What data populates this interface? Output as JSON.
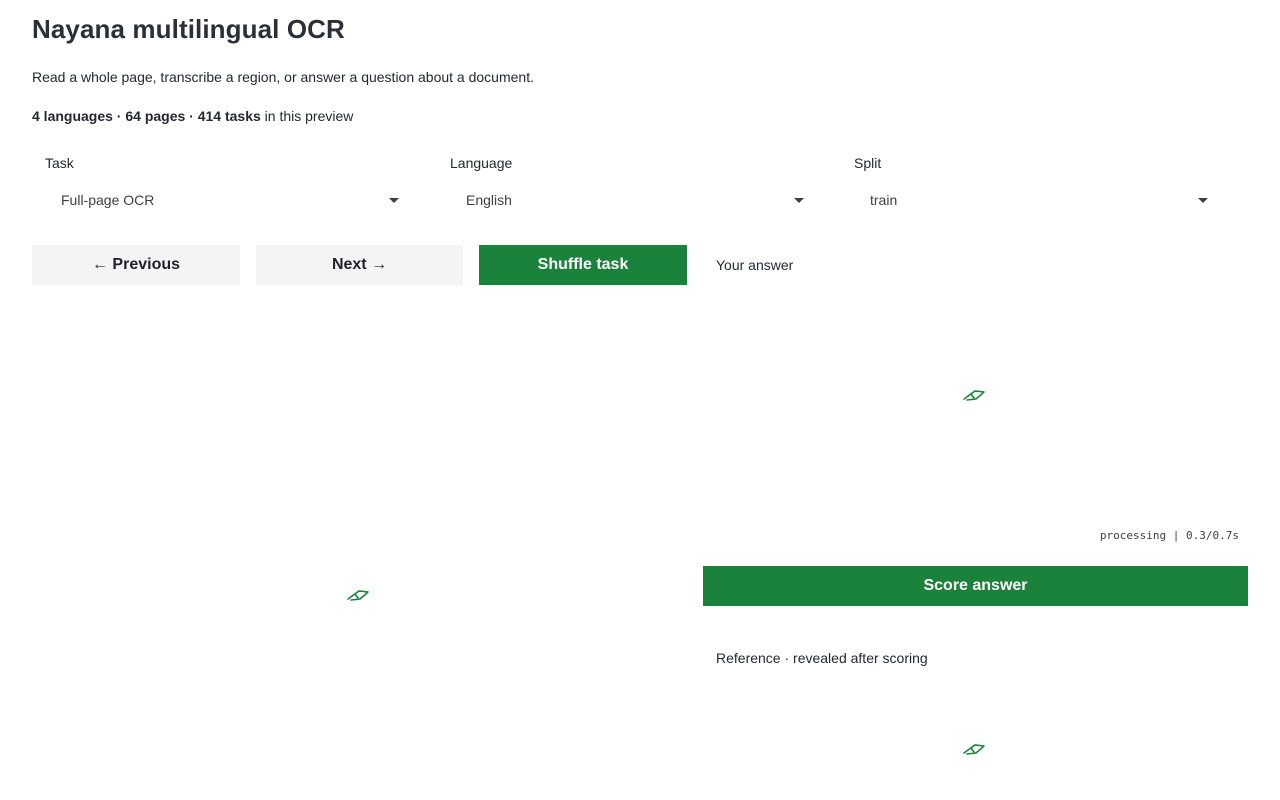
{
  "header": {
    "title": "Nayana multilingual OCR",
    "subtitle": "Read a whole page, transcribe a region, or answer a question about a document.",
    "stats_bold": "4 languages · 64 pages · 414 tasks",
    "stats_suffix": " in this preview"
  },
  "controls": {
    "task": {
      "label": "Task",
      "value": "Full-page OCR"
    },
    "language": {
      "label": "Language",
      "value": "English"
    },
    "split": {
      "label": "Split",
      "value": "train"
    }
  },
  "buttons": {
    "previous": "← Previous",
    "next": "Next →",
    "shuffle": "Shuffle task",
    "score": "Score answer"
  },
  "answer": {
    "label": "Your answer",
    "timer": "processing | 0.3/0.7s"
  },
  "reference": {
    "label": "Reference · revealed after scoring"
  },
  "icons": {
    "loading": "loading-spinner-icon"
  },
  "colors": {
    "primary": "#1b823b",
    "secondary_bg": "#f3f4f6",
    "text": "#24292f"
  }
}
